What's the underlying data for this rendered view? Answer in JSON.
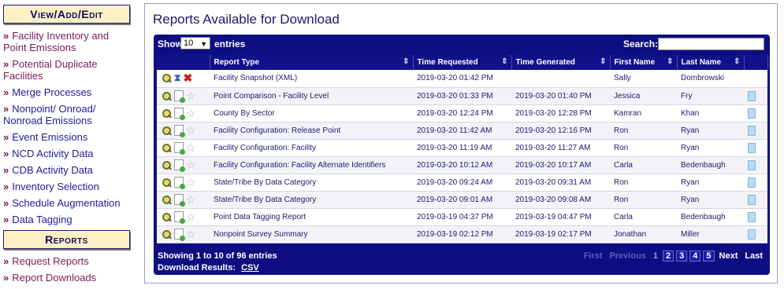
{
  "sidebar": {
    "view_header": "View/Add/Edit",
    "items": [
      {
        "label": "Facility Inventory and Point Emissions",
        "visited": true
      },
      {
        "label": "Potential Duplicate Facilities",
        "visited": true
      },
      {
        "label": "Merge Processes",
        "visited": false
      },
      {
        "label": "Nonpoint/ Onroad/ Nonroad Emissions",
        "visited": false
      },
      {
        "label": "Event Emissions",
        "visited": false
      },
      {
        "label": "NCD Activity Data",
        "visited": false
      },
      {
        "label": "CDB Activity Data",
        "visited": false
      },
      {
        "label": "Inventory Selection",
        "visited": false
      },
      {
        "label": "Schedule Augmentation",
        "visited": false
      },
      {
        "label": "Data Tagging",
        "visited": false
      }
    ],
    "reports_header": "Reports",
    "report_items": [
      {
        "label": "Request Reports"
      },
      {
        "label": "Report Downloads"
      }
    ],
    "arrow": "»"
  },
  "main": {
    "title": "Reports Available for Download",
    "show_label": "Show",
    "entries_value": "10",
    "entries_label": "entries",
    "search_label": "Search:",
    "search_value": "",
    "columns": [
      "",
      "Report Type",
      "Time Requested",
      "Time Generated",
      "First Name",
      "Last Name",
      ""
    ],
    "rows": [
      {
        "status": "pending",
        "type": "Facility Snapshot (XML)",
        "requested": "2019-03-20 01:42 PM",
        "generated": "",
        "first": "Sally",
        "last": "Dombrowski"
      },
      {
        "status": "done",
        "type": "Point Comparison - Facility Level",
        "requested": "2019-03-20 01:33 PM",
        "generated": "2019-03-20 01:40 PM",
        "first": "Jessica",
        "last": "Fry"
      },
      {
        "status": "done",
        "type": "County By Sector",
        "requested": "2019-03-20 12:24 PM",
        "generated": "2019-03-20 12:28 PM",
        "first": "Kamran",
        "last": "Khan"
      },
      {
        "status": "done",
        "type": "Facility Configuration: Release Point",
        "requested": "2019-03-20 11:42 AM",
        "generated": "2019-03-20 12:16 PM",
        "first": "Ron",
        "last": "Ryan"
      },
      {
        "status": "done",
        "type": "Facility Configuration: Facility",
        "requested": "2019-03-20 11:19 AM",
        "generated": "2019-03-20 11:27 AM",
        "first": "Ron",
        "last": "Ryan"
      },
      {
        "status": "done",
        "type": "Facility Configuration: Facility Alternate Identifiers",
        "requested": "2019-03-20 10:12 AM",
        "generated": "2019-03-20 10:17 AM",
        "first": "Carla",
        "last": "Bedenbaugh"
      },
      {
        "status": "done",
        "type": "State/Tribe By Data Category",
        "requested": "2019-03-20 09:24 AM",
        "generated": "2019-03-20 09:31 AM",
        "first": "Ron",
        "last": "Ryan"
      },
      {
        "status": "done",
        "type": "State/Tribe By Data Category",
        "requested": "2019-03-20 09:01 AM",
        "generated": "2019-03-20 09:08 AM",
        "first": "Ron",
        "last": "Ryan"
      },
      {
        "status": "done",
        "type": "Point Data Tagging Report",
        "requested": "2019-03-19 04:37 PM",
        "generated": "2019-03-19 04:47 PM",
        "first": "Carla",
        "last": "Bedenbaugh"
      },
      {
        "status": "done",
        "type": "Nonpoint Survey Summary",
        "requested": "2019-03-19 02:12 PM",
        "generated": "2019-03-19 02:17 PM",
        "first": "Jonathan",
        "last": "Miller"
      }
    ],
    "info": "Showing 1 to 10 of 96 entries",
    "download_label": "Download Results:",
    "download_csv": "CSV",
    "pagination": {
      "first": "First",
      "previous": "Previous",
      "pages": [
        "1",
        "2",
        "3",
        "4",
        "5"
      ],
      "current": "1",
      "next": "Next",
      "last": "Last"
    }
  }
}
